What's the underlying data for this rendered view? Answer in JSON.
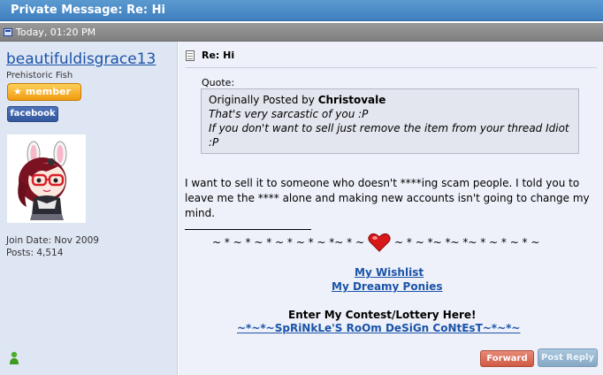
{
  "header": {
    "label": "Private Message:",
    "subject": "Re: Hi"
  },
  "datebar": {
    "timestamp": "Today, 01:20 PM"
  },
  "sender": {
    "username": "beautifuldisgrace13",
    "title": "Prehistoric Fish",
    "member_badge": "member",
    "facebook_badge": "facebook",
    "join_date": "Join Date: Nov 2009",
    "posts": "Posts: 4,514"
  },
  "post": {
    "title": "Re: Hi",
    "quote_label": "Quote:",
    "quote_prefix": "Originally Posted by",
    "quote_author": "Christovale",
    "quote_line1": "That's very sarcastic of you :P",
    "quote_line2": "If you don't want to sell just remove the item from your thread Idiot :P",
    "message": "I want to sell it to someone who doesn't ****ing scam people. I told you to leave me the **** alone and making new accounts isn't going to change my mind."
  },
  "signature": {
    "deco_left": "~ * ~ * ~ * ~ * ~ * ~ *~ * ~",
    "deco_right": "~ * ~ *~ *~ *~ * ~ * ~ * ~",
    "wishlist_link": "My Wishlist",
    "ponies_link": "My Dreamy Ponies",
    "contest_heading": "Enter My Contest/Lottery Here!",
    "contest_link": "~*~*~SpRiNkLe'S RoOm DeSiGn CoNtEsT~*~*~"
  },
  "actions": {
    "forward": "Forward",
    "reply": "Post Reply"
  },
  "colors": {
    "titlebar": "#4a8ac8",
    "link": "#1a53a8",
    "sidebar": "#dfe6f3",
    "content": "#eef1f9"
  }
}
